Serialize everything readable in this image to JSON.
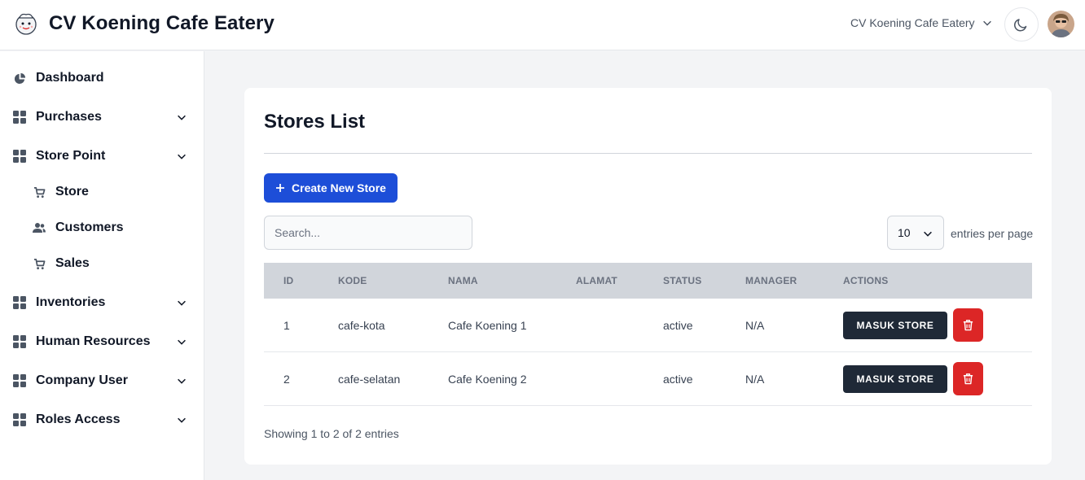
{
  "header": {
    "title": "CV Koening Cafe Eatery",
    "company_selected": "CV Koening Cafe Eatery",
    "logo_icon": "chef-mascot-icon",
    "theme_icon": "moon-icon"
  },
  "sidebar": {
    "items": [
      {
        "label": "Dashboard",
        "icon": "pie-chart-icon",
        "expandable": false
      },
      {
        "label": "Purchases",
        "icon": "grid-icon",
        "expandable": true
      },
      {
        "label": "Store Point",
        "icon": "grid-icon",
        "expandable": true,
        "expanded": true
      },
      {
        "label": "Store",
        "icon": "cart-icon",
        "sub": true
      },
      {
        "label": "Customers",
        "icon": "users-icon",
        "sub": true
      },
      {
        "label": "Sales",
        "icon": "cart-icon",
        "sub": true
      },
      {
        "label": "Inventories",
        "icon": "grid-icon",
        "expandable": true
      },
      {
        "label": "Human Resources",
        "icon": "grid-icon",
        "expandable": true
      },
      {
        "label": "Company User",
        "icon": "grid-icon",
        "expandable": true
      },
      {
        "label": "Roles Access",
        "icon": "grid-icon",
        "expandable": true
      }
    ]
  },
  "main": {
    "title": "Stores List",
    "create_button": "Create New Store",
    "search_placeholder": "Search...",
    "per_page_value": "10",
    "per_page_label": "entries per page",
    "columns": [
      "ID",
      "KODE",
      "NAMA",
      "ALAMAT",
      "STATUS",
      "MANAGER",
      "ACTIONS"
    ],
    "rows": [
      {
        "id": "1",
        "kode": "cafe-kota",
        "nama": "Cafe Koening 1",
        "alamat": "",
        "status": "active",
        "manager": "N/A",
        "action": "MASUK STORE"
      },
      {
        "id": "2",
        "kode": "cafe-selatan",
        "nama": "Cafe Koening 2",
        "alamat": "",
        "status": "active",
        "manager": "N/A",
        "action": "MASUK STORE"
      }
    ],
    "showing_text": "Showing 1 to 2 of 2 entries"
  },
  "colors": {
    "primary": "#1d4ed8",
    "dark_button": "#1f2937",
    "danger": "#dc2626",
    "table_header": "#d1d5db",
    "page_bg": "#f3f4f6"
  }
}
